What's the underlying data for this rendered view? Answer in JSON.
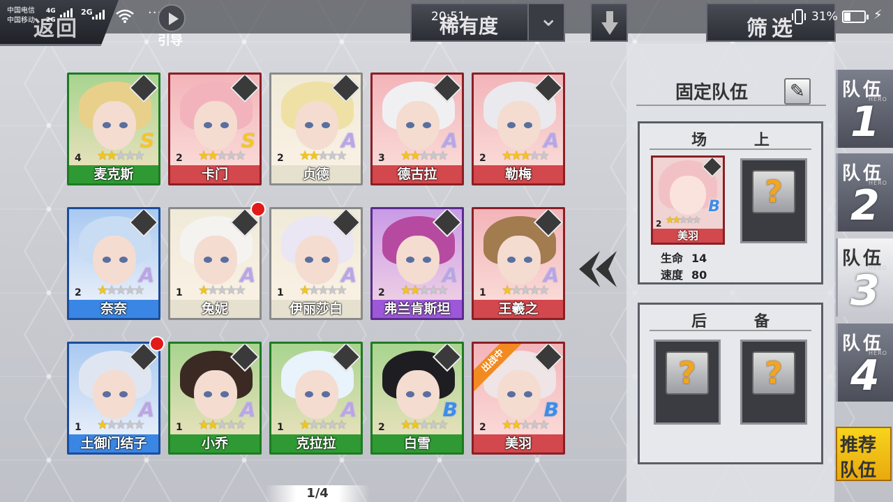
{
  "status_bar": {
    "carrier_1": "中国电信",
    "carrier_2": "中国移动",
    "net_1": "4G",
    "net_1b": "2G",
    "net_2": "2G",
    "time": "20:51",
    "battery": "31%"
  },
  "header": {
    "back_label": "返回",
    "guide_label": "引导",
    "sort_label": "稀有度",
    "filter_label": "筛选"
  },
  "heroes": [
    {
      "name": "麦克斯",
      "level": "4",
      "stars": 2,
      "rank": "S",
      "rarity": "green",
      "icon": "crosshair-icon"
    },
    {
      "name": "卡门",
      "level": "2",
      "stars": 2,
      "rank": "S",
      "rarity": "red",
      "icon": "mask-icon"
    },
    {
      "name": "贞德",
      "level": "2",
      "stars": 2,
      "rank": "A",
      "rarity": "white",
      "icon": "shield-icon"
    },
    {
      "name": "德古拉",
      "level": "3",
      "stars": 2,
      "rank": "A",
      "rarity": "red",
      "icon": "shuriken-icon"
    },
    {
      "name": "勒梅",
      "level": "2",
      "stars": 3,
      "rank": "A",
      "rarity": "red",
      "icon": "cross-icon"
    },
    {
      "name": "奈奈",
      "level": "2",
      "stars": 1,
      "rank": "A",
      "rarity": "blue",
      "icon": "eye-icon"
    },
    {
      "name": "兔妮",
      "level": "1",
      "stars": 1,
      "rank": "A",
      "rarity": "white",
      "icon": "flask-icon",
      "red_dot": true
    },
    {
      "name": "伊丽莎白",
      "level": "1",
      "stars": 1,
      "rank": "A",
      "rarity": "white",
      "icon": "sword-icon"
    },
    {
      "name": "弗兰肯斯坦",
      "level": "2",
      "stars": 2,
      "rank": "A",
      "rarity": "purple",
      "icon": "hammer-icon"
    },
    {
      "name": "王羲之",
      "level": "1",
      "stars": 1,
      "rank": "A",
      "rarity": "red",
      "icon": "fist-icon"
    },
    {
      "name": "土御门结子",
      "level": "1",
      "stars": 1,
      "rank": "A",
      "rarity": "blue",
      "icon": "crosshair-icon",
      "red_dot": true
    },
    {
      "name": "小乔",
      "level": "1",
      "stars": 2,
      "rank": "A",
      "rarity": "green",
      "icon": "hammer-icon"
    },
    {
      "name": "克拉拉",
      "level": "1",
      "stars": 1,
      "rank": "A",
      "rarity": "green",
      "icon": "bow-icon"
    },
    {
      "name": "白雪",
      "level": "2",
      "stars": 2,
      "rank": "B",
      "rarity": "green",
      "icon": "shield-icon"
    },
    {
      "name": "美羽",
      "level": "2",
      "stars": 2,
      "rank": "B",
      "rarity": "red",
      "icon": "crosshair-icon",
      "deployed_tag": "出战中"
    }
  ],
  "pager": "1/4",
  "team": {
    "title": "固定队伍",
    "on_field_label": "场 上",
    "reserve_label": "后 备",
    "member": {
      "name": "美羽",
      "level": "2",
      "stars": 2,
      "rank": "B"
    },
    "stats": [
      {
        "label": "生命",
        "value": "14"
      },
      {
        "label": "速度",
        "value": "80"
      }
    ],
    "empty_symbol": "?"
  },
  "tabs": [
    {
      "label": "队伍",
      "num": "1",
      "hero": "HERO"
    },
    {
      "label": "队伍",
      "num": "2",
      "hero": "HERO"
    },
    {
      "label": "队伍",
      "num": "3",
      "hero": "HERO"
    },
    {
      "label": "队伍",
      "num": "4",
      "hero": "HERO"
    }
  ],
  "recommend": {
    "line1": "推荐",
    "line2": "队伍"
  }
}
